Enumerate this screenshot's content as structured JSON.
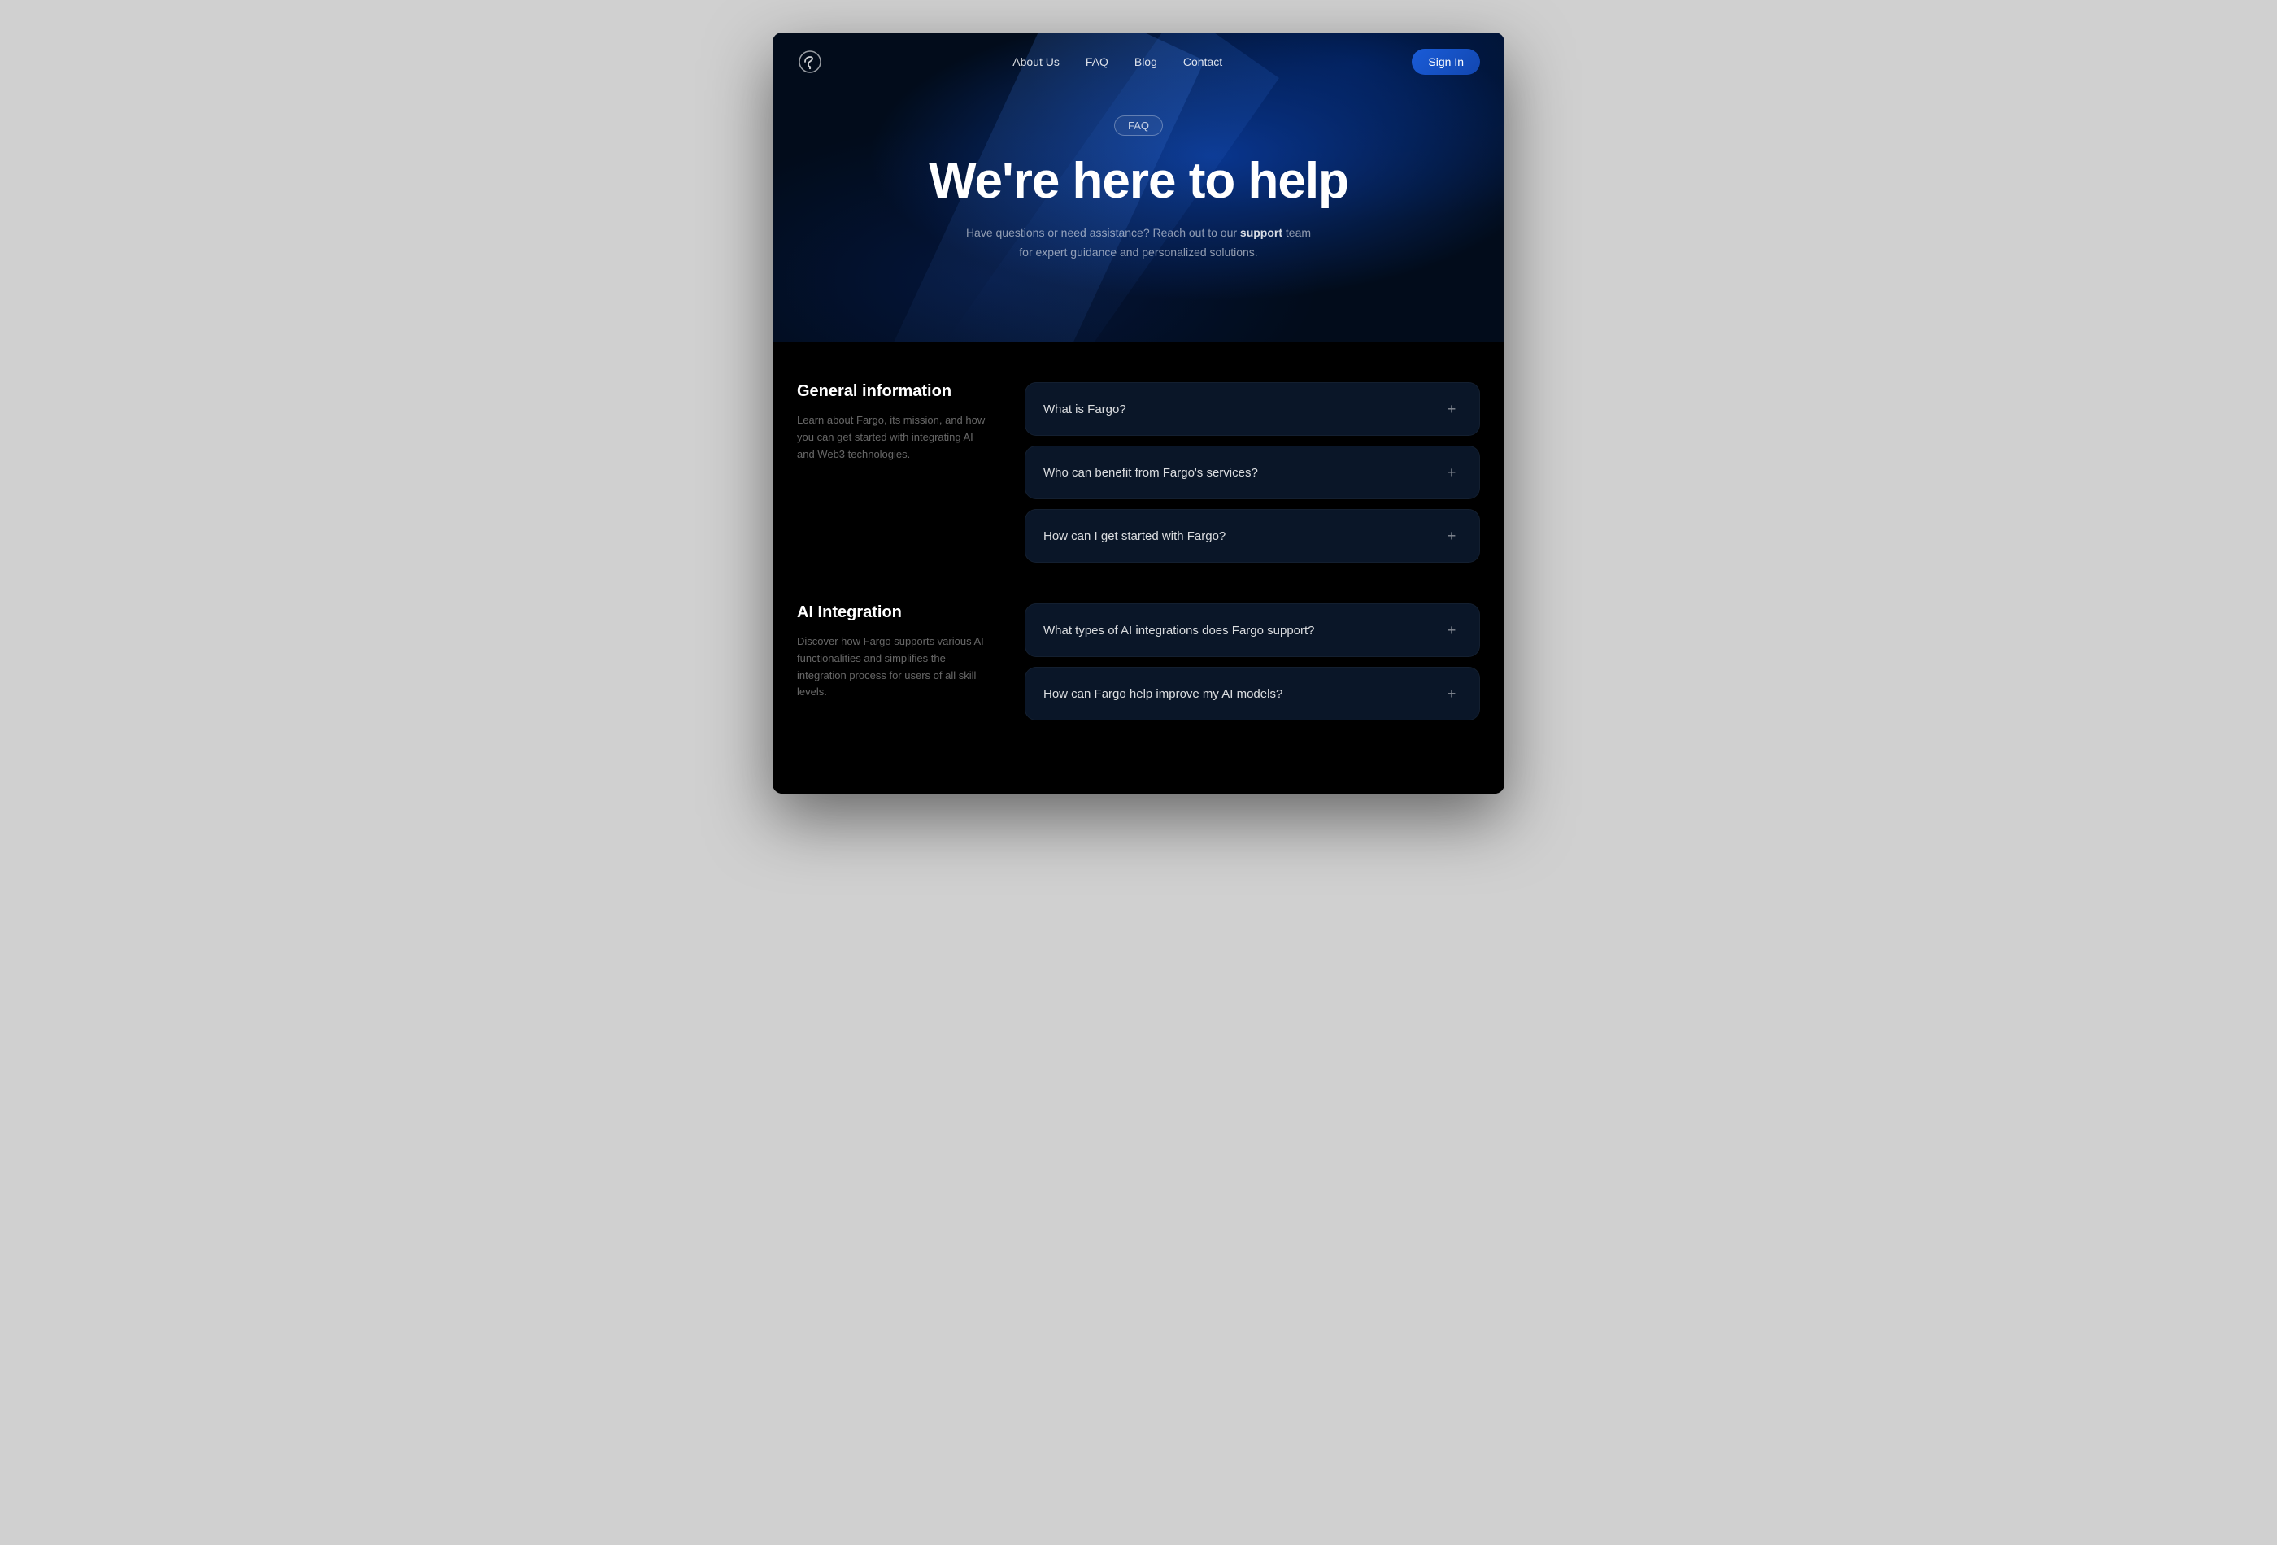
{
  "nav": {
    "logo_alt": "Fargo Logo",
    "links": [
      {
        "label": "About Us",
        "id": "about"
      },
      {
        "label": "FAQ",
        "id": "faq"
      },
      {
        "label": "Blog",
        "id": "blog"
      },
      {
        "label": "Contact",
        "id": "contact"
      }
    ],
    "sign_in": "Sign In"
  },
  "hero": {
    "badge": "FAQ",
    "title": "We're here to help",
    "subtitle_pre": "Have questions or need assistance? Reach out to our ",
    "subtitle_bold": "support",
    "subtitle_post": " team for expert guidance and personalized solutions."
  },
  "sections": [
    {
      "id": "general",
      "title": "General information",
      "desc": "Learn about Fargo, its mission, and how you can get started with integrating AI and Web3 technologies.",
      "faqs": [
        {
          "question": "What is Fargo?"
        },
        {
          "question": "Who can benefit from Fargo's services?"
        },
        {
          "question": "How can I get started with Fargo?"
        }
      ]
    },
    {
      "id": "ai",
      "title": "AI Integration",
      "desc": "Discover how Fargo supports various AI functionalities and simplifies the integration process for users of all skill levels.",
      "faqs": [
        {
          "question": "What types of AI integrations does Fargo support?"
        },
        {
          "question": "How can Fargo help improve my AI models?"
        }
      ]
    }
  ]
}
